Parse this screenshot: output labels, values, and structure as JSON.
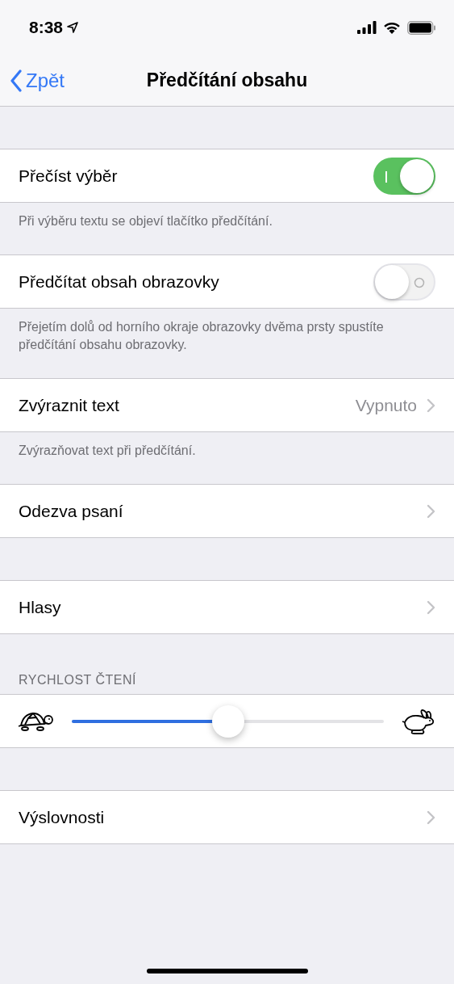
{
  "status_bar": {
    "time": "8:38"
  },
  "nav": {
    "back": "Zpět",
    "title": "Předčítání obsahu"
  },
  "groups": [
    {
      "rows": [
        {
          "kind": "toggle",
          "label": "Přečíst výběr",
          "on": true
        }
      ],
      "footer": "Při výběru textu se objeví tlačítko předčítání."
    },
    {
      "rows": [
        {
          "kind": "toggle",
          "label": "Předčítat obsah obrazovky",
          "on": false
        }
      ],
      "footer": "Přejetím dolů od horního okraje obrazovky dvěma prsty spustíte předčítání obsahu obrazovky."
    },
    {
      "rows": [
        {
          "kind": "link",
          "label": "Zvýraznit text",
          "value": "Vypnuto"
        }
      ],
      "footer": "Zvýrazňovat text při předčítání."
    },
    {
      "rows": [
        {
          "kind": "link",
          "label": "Odezva psaní"
        }
      ]
    },
    {
      "rows": [
        {
          "kind": "link",
          "label": "Hlasy"
        }
      ]
    },
    {
      "header": "RYCHLOST ČTENÍ",
      "rows": [
        {
          "kind": "slider",
          "level": 0.5
        }
      ]
    },
    {
      "rows": [
        {
          "kind": "link",
          "label": "Výslovnosti"
        }
      ]
    }
  ]
}
